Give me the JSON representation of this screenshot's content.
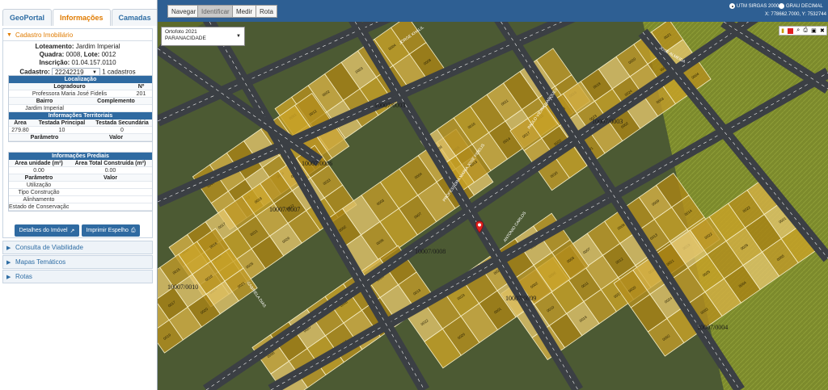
{
  "tabs": [
    "GeoPortal",
    "Informações",
    "Camadas"
  ],
  "cadastro": {
    "header": "Cadastro Imobiliário",
    "loteamento_label": "Loteamento:",
    "loteamento_value": "Jardim Imperial",
    "quadra_label": "Quadra:",
    "quadra_value": "0008,",
    "lote_label": "Lote:",
    "lote_value": "0012",
    "inscricao_label": "Inscrição:",
    "inscricao_value": "01.04.157.0110",
    "cadastro_label": "Cadastro:",
    "cadastro_value": "22242219",
    "cadastro_count": "1 cadastros"
  },
  "localizacao": {
    "title": "Localização",
    "h_logradouro": "Logradouro",
    "h_numero": "Nº",
    "logradouro": "Professora Maria José Fidelis",
    "numero": "201",
    "h_bairro": "Bairro",
    "h_complemento": "Complemento",
    "bairro": "Jardim Imperial",
    "complemento": ""
  },
  "territoriais": {
    "title": "Informações Territoriais",
    "h_area": "Área",
    "h_testada_principal": "Testada Principal",
    "h_testada_secundaria": "Testada Secundária",
    "area": "279.80",
    "testada_principal": "10",
    "testada_secundaria": "0",
    "h_parametro": "Parâmetro",
    "h_valor": "Valor"
  },
  "prediais": {
    "title": "Informações Prediais",
    "h_area_unidade": "Área unidade (m²)",
    "h_area_total": "Área Total Construída (m²)",
    "area_unidade": "0.00",
    "area_total": "0.00",
    "h_parametro": "Parâmetro",
    "h_valor": "Valor",
    "params": [
      "Utilização",
      "Tipo Construção",
      "Alinhamento",
      "Estado de Conservação"
    ]
  },
  "buttons": {
    "detalhes": "Detalhes do Imóvel",
    "imprimir": "Imprimir Espelho"
  },
  "accordions": [
    "Consulta de Viabilidade",
    "Mapas Temáticos",
    "Rotas"
  ],
  "map_tools": [
    "Navegar",
    "Identificar",
    "Medir",
    "Rota"
  ],
  "projection": {
    "utm": "UTM SIRGAS 2000",
    "grau": "GRAU DECIMAL",
    "coords": "X: 778662.7000, Y: 7532744"
  },
  "basemap": {
    "name": "Ortofoto 2021",
    "city": "PARANACIDADE"
  },
  "map_labels": {
    "blocks": [
      "10007/0003",
      "10007/0006",
      "10007/0007",
      "10007/0008",
      "10007/0009",
      "10007/0004",
      "10007/0010"
    ],
    "streets": [
      "JORGE KHALIL",
      "PROFESSORA MARIA JOSE FIDELIS",
      "PAULO VIEIRA MARQUES",
      "JOSE ALMEIDA",
      "GABRIELA DIAS",
      "ANTONIO CARLOS"
    ],
    "lots": [
      "0001",
      "0002",
      "0003",
      "0004",
      "0005",
      "0006",
      "0007",
      "0008",
      "0009",
      "0010",
      "0011",
      "0012",
      "0013",
      "0014",
      "0015",
      "0016",
      "0017",
      "0018",
      "0019",
      "0020",
      "0021",
      "0022",
      "0023",
      "0024",
      "0025",
      "0026"
    ]
  },
  "colors": {
    "accent": "#e07b00",
    "blue": "#2f6aa1",
    "parcel": "#c9a227"
  }
}
